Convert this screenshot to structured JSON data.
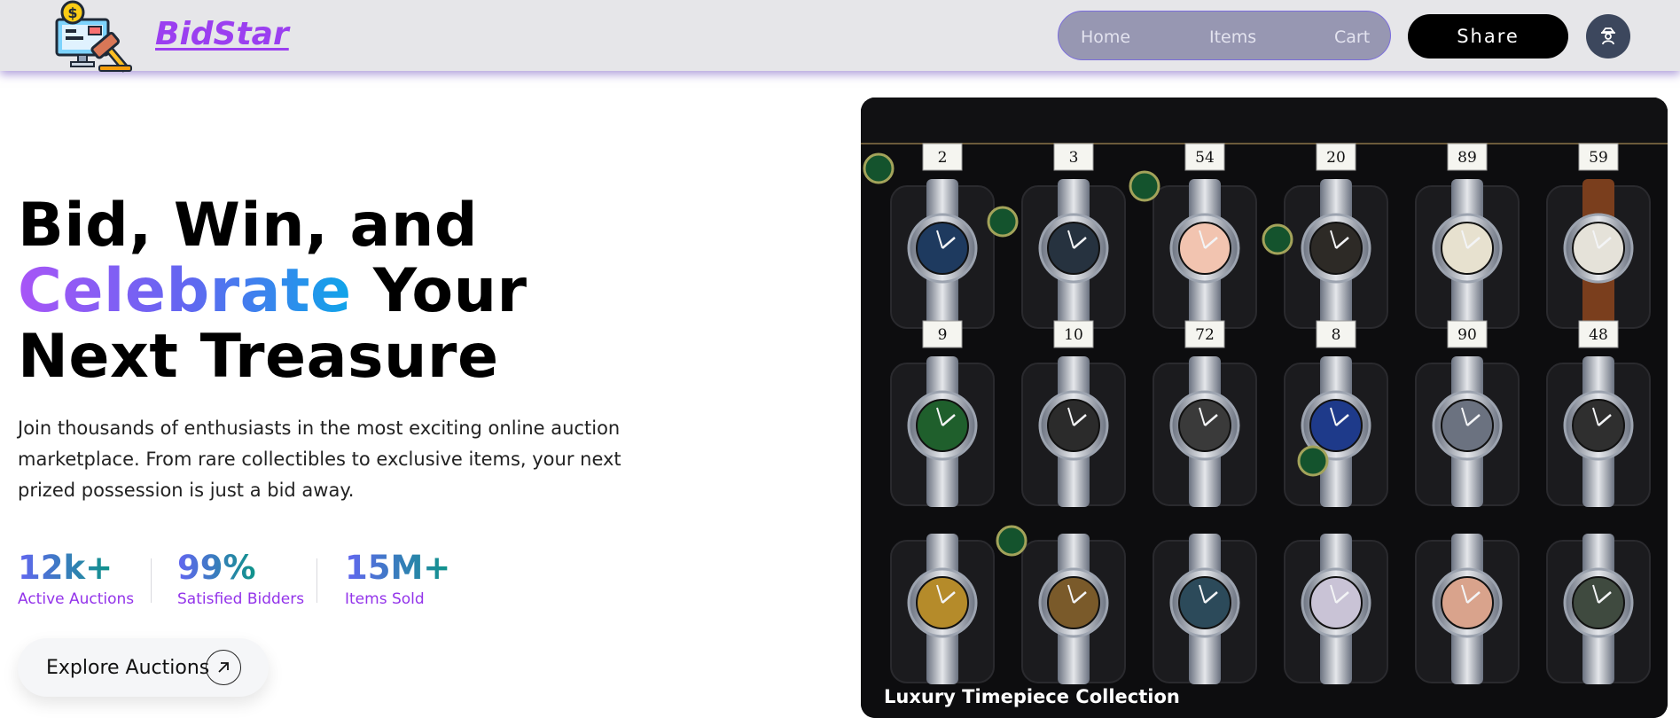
{
  "header": {
    "brand": "BidStar",
    "logo_icon": "auction-computer-gavel-icon",
    "nav": {
      "home": "Home",
      "items": "Items",
      "cart": "Cart"
    },
    "share_label": "Share",
    "account_icon": "user-icon"
  },
  "hero": {
    "title_line1": "Bid, Win, and",
    "title_highlight": "Celebrate",
    "title_line2_rest": " Your",
    "title_line3": "Next Treasure",
    "description": "Join thousands of enthusiasts in the most exciting online auction marketplace. From rare collectibles to exclusive items, your next prized possession is just a bid away.",
    "stats": [
      {
        "value": "12k+",
        "label": "Active Auctions"
      },
      {
        "value": "99%",
        "label": "Satisfied Bidders"
      },
      {
        "value": "15M+",
        "label": "Items Sold"
      }
    ],
    "cta_label": "Explore Auctions",
    "cta_icon": "arrow-up-right-icon",
    "image": {
      "subject": "watch-collection-photo",
      "caption": "Luxury Timepiece Collection",
      "tags": [
        [
          "2",
          "3",
          "54",
          "20",
          "89",
          "59"
        ],
        [
          "9",
          "10",
          "72",
          "8",
          "90",
          "48"
        ],
        [
          "",
          "",
          "",
          "",
          "",
          ""
        ]
      ]
    }
  },
  "colors": {
    "brand": "#9b3ff0",
    "header_bg": "#e6e6e9",
    "nav_bg": "#9797b2",
    "gradient_start": "#a855f7",
    "gradient_end": "#0ea5e9",
    "stat_label": "#9333ea"
  }
}
